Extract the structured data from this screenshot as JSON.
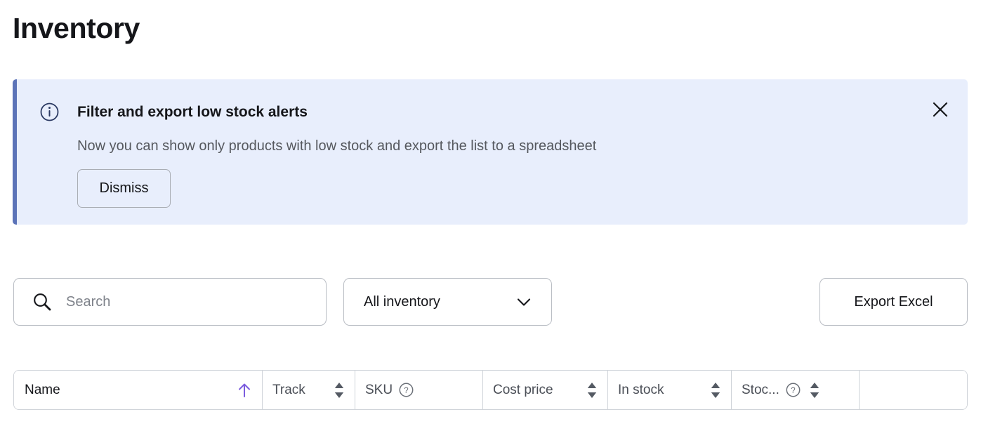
{
  "page": {
    "title": "Inventory"
  },
  "banner": {
    "icon": "info-circle-icon",
    "heading": "Filter and export low stock alerts",
    "body": "Now you can show only products with low stock and export the list to a spreadsheet",
    "dismiss_label": "Dismiss",
    "close_icon": "close-icon",
    "background_color": "#e8eefc",
    "accent_color": "#5b73b8"
  },
  "toolbar": {
    "search": {
      "icon": "search-icon",
      "placeholder": "Search",
      "value": ""
    },
    "filter": {
      "selected": "All inventory",
      "icon": "chevron-down-icon",
      "options": [
        "All inventory"
      ]
    },
    "export_label": "Export Excel"
  },
  "table": {
    "sort_active_color": "#7b5cde",
    "columns": [
      {
        "label": "Name",
        "sort": "ascending",
        "help": false
      },
      {
        "label": "Track",
        "sort": "sortable",
        "help": false
      },
      {
        "label": "SKU",
        "sort": "none",
        "help": true
      },
      {
        "label": "Cost price",
        "sort": "sortable",
        "help": false
      },
      {
        "label": "In stock",
        "sort": "sortable",
        "help": false
      },
      {
        "label": "Stoc...",
        "sort": "sortable",
        "help": true
      },
      {
        "label": "",
        "sort": "none",
        "help": false
      }
    ]
  }
}
